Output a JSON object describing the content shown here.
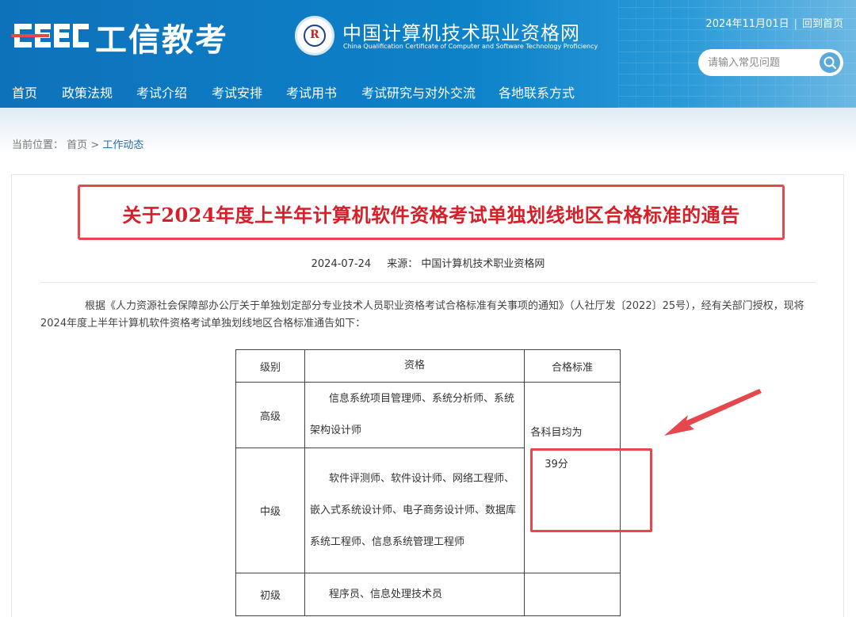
{
  "header": {
    "logo_ceec": "CEEC",
    "logo_text": "工信教考",
    "site_name_cn": "中国计算机技术职业资格网",
    "site_name_en": "China Qualification Certificate of Computer and Software Technology Proficiency",
    "date": "2024年11月01日",
    "home_link": "回到首页",
    "search_placeholder": "请输入常见问题",
    "accent_color": "#0e72ba"
  },
  "nav": [
    {
      "label": "首页",
      "active": true
    },
    {
      "label": "政策法规"
    },
    {
      "label": "考试介绍"
    },
    {
      "label": "考试安排"
    },
    {
      "label": "考试用书"
    },
    {
      "label": "考试研究与对外交流"
    },
    {
      "label": "各地联系方式"
    }
  ],
  "breadcrumb": {
    "prefix": "当前位置：",
    "home": "首页",
    "sep": ">",
    "current": "工作动态"
  },
  "article": {
    "title": "关于2024年度上半年计算机软件资格考试单独划线地区合格标准的通告",
    "date": "2024-07-24",
    "source": "来源：  中国计算机技术职业资格网",
    "paragraph": "根据《人力资源社会保障部办公厅关于单独划定部分专业技术人员职业资格考试合格标准有关事项的通知》（人社厅发〔2022〕25号），经有关部门授权，现将2024年度上半年计算机软件资格考试单独划线地区合格标准通告如下：",
    "highlight_color": "#e5474c"
  },
  "table": {
    "headers": [
      "级别",
      "资格",
      "合格标准"
    ],
    "rows": [
      {
        "level": "高级",
        "qualifications": "信息系统项目管理师、系统分析师、系统架构设计师"
      },
      {
        "level": "中级",
        "qualifications": "软件评测师、软件设计师、网络工程师、嵌入式系统设计师、电子商务设计师、数据库系统工程师、信息系统管理工程师"
      },
      {
        "level": "初级",
        "qualifications": "程序员、信息处理技术员"
      }
    ],
    "standard_line1": "各科目均为",
    "standard_line2": "39分"
  }
}
